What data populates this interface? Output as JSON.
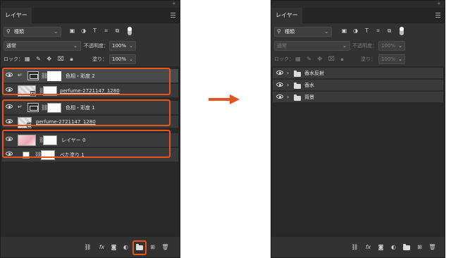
{
  "accent": "#e8531f",
  "left": {
    "tab": "レイヤー",
    "filter": "種類",
    "blend_mode": "通常",
    "opacity_label": "不透明度：",
    "opacity_value": "100%",
    "lock_label": "ロック：",
    "fill_label": "塗り：",
    "fill_value": "100%",
    "layers": [
      {
        "name": "色相・彩度 2"
      },
      {
        "name": "perfume-2721147_1280"
      },
      {
        "name": "色相・彩度 1"
      },
      {
        "name": "perfume-2721147_1280"
      },
      {
        "name": "レイヤー 0"
      },
      {
        "name": "べた塗り 1"
      }
    ]
  },
  "right": {
    "tab": "レイヤー",
    "filter": "種類",
    "blend_mode": "通常",
    "opacity_label": "不透明度：",
    "opacity_value": "100%",
    "lock_label": "ロック：",
    "fill_label": "塗り：",
    "fill_value": "100%",
    "groups": [
      {
        "name": "香水反射"
      },
      {
        "name": "香水"
      },
      {
        "name": "背景"
      }
    ]
  },
  "icons": {
    "collapse": "«",
    "chevron": "⌄",
    "search": "🔍",
    "link": "⛓",
    "fx": "fx",
    "expand": "›"
  }
}
